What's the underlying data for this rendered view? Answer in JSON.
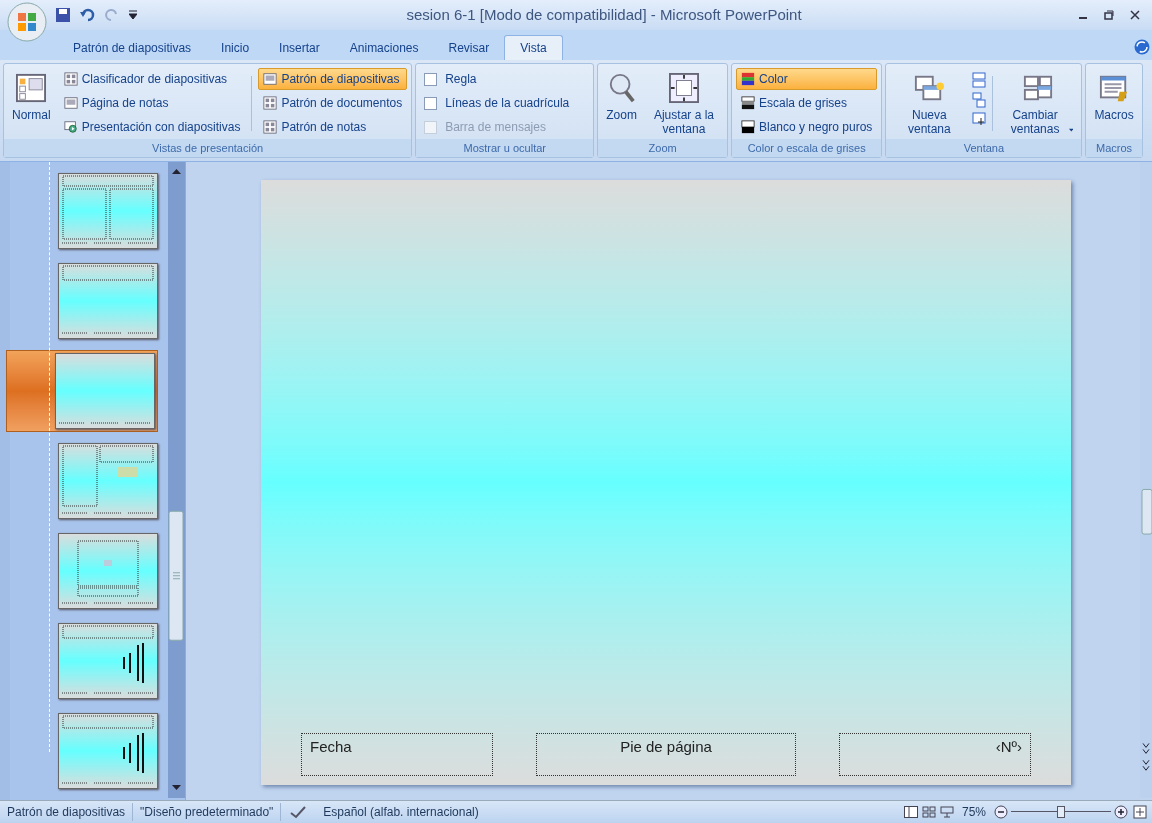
{
  "window": {
    "title": "sesion 6-1 [Modo de compatibilidad] - Microsoft PowerPoint"
  },
  "tabs": [
    {
      "label": "Patrón de diapositivas",
      "selected": false
    },
    {
      "label": "Inicio",
      "selected": false
    },
    {
      "label": "Insertar",
      "selected": false
    },
    {
      "label": "Animaciones",
      "selected": false
    },
    {
      "label": "Revisar",
      "selected": false
    },
    {
      "label": "Vista",
      "selected": true
    }
  ],
  "ribbon": {
    "groups": [
      {
        "label": "Vistas de presentación",
        "big": {
          "label": "Normal"
        },
        "items": [
          {
            "label": "Clasificador de diapositivas",
            "selected": false
          },
          {
            "label": "Página de notas",
            "selected": false
          },
          {
            "label": "Presentación con diapositivas",
            "selected": false
          }
        ],
        "items2": [
          {
            "label": "Patrón de diapositivas",
            "selected": true
          },
          {
            "label": "Patrón de documentos",
            "selected": false
          },
          {
            "label": "Patrón de notas",
            "selected": false
          }
        ]
      },
      {
        "label": "Mostrar u ocultar",
        "checks": [
          {
            "label": "Regla",
            "checked": false,
            "disabled": false
          },
          {
            "label": "Líneas de la cuadrícula",
            "checked": false,
            "disabled": false
          },
          {
            "label": "Barra de mensajes",
            "checked": false,
            "disabled": true
          }
        ]
      },
      {
        "label": "Zoom",
        "bigs": [
          {
            "label": "Zoom"
          },
          {
            "label": "Ajustar a la ventana"
          }
        ]
      },
      {
        "label": "Color o escala de grises",
        "modes": [
          {
            "label": "Color",
            "selected": true
          },
          {
            "label": "Escala de grises",
            "selected": false
          },
          {
            "label": "Blanco y negro puros",
            "selected": false
          }
        ]
      },
      {
        "label": "Ventana",
        "bigs": [
          {
            "label": "Nueva ventana",
            "dropdown": false
          },
          {
            "label": "Cambiar ventanas",
            "dropdown": true
          }
        ]
      },
      {
        "label": "Macros",
        "bigs": [
          {
            "label": "Macros"
          }
        ]
      }
    ]
  },
  "thumbnails": [
    {
      "kind": "two",
      "selected": false
    },
    {
      "kind": "title",
      "selected": false
    },
    {
      "kind": "blank",
      "selected": true
    },
    {
      "kind": "content",
      "selected": false
    },
    {
      "kind": "picture",
      "selected": false
    },
    {
      "kind": "vertical",
      "selected": false
    },
    {
      "kind": "vertical",
      "selected": false
    }
  ],
  "slide": {
    "footer": [
      "Fecha",
      "Pie de página",
      "‹Nº›"
    ]
  },
  "status_bar": {
    "items": [
      "Patrón de diapositivas",
      "\"Diseño predeterminado\""
    ],
    "language": "Español (alfab. internacional)",
    "zoom": "75%",
    "zoom_slider": {
      "level": 0.5
    }
  }
}
